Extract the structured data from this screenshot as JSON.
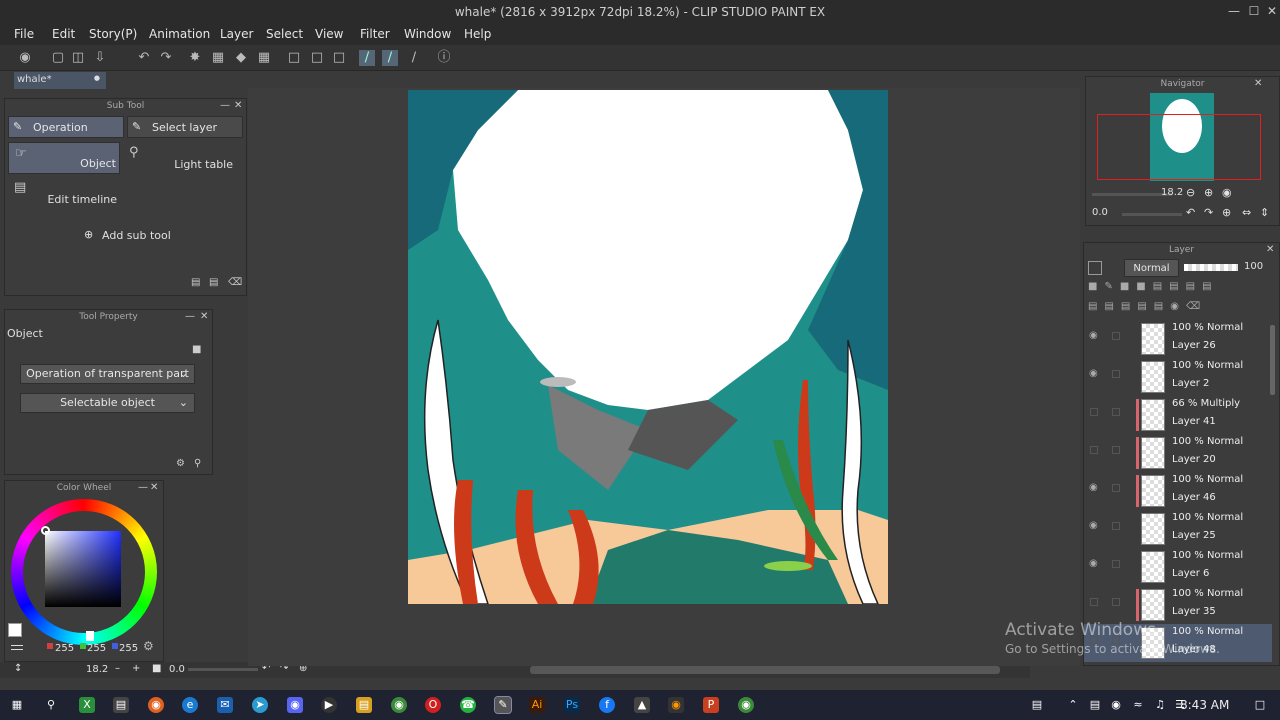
{
  "window": {
    "title": "whale* (2816 x 3912px 72dpi 18.2%) - CLIP STUDIO PAINT EX"
  },
  "menu": [
    "File",
    "Edit",
    "Story(P)",
    "Animation",
    "Layer",
    "Select",
    "View",
    "Filter",
    "Window",
    "Help"
  ],
  "document_tab": {
    "label": "whale*"
  },
  "subtool": {
    "title": "Sub Tool",
    "operation": "Operation",
    "select_layer": "Select layer",
    "object": "Object",
    "light_table": "Light table",
    "edit_timeline": "Edit timeline",
    "add_sub_tool": "Add sub tool"
  },
  "tool_property": {
    "title": "Tool Property",
    "object": "Object",
    "transparent_part": "Operation of transparent part",
    "selectable_object": "Selectable object"
  },
  "color_wheel": {
    "title": "Color Wheel",
    "r": "255",
    "g": "255",
    "b": "255",
    "r_color": "#d04040",
    "g_color": "#40c040",
    "b_color": "#4060e0"
  },
  "bottom_bar": {
    "zoom": "18.2",
    "angle": "0.0"
  },
  "navigator": {
    "title": "Navigator",
    "zoom": "18.2",
    "angle": "0.0"
  },
  "layer_panel": {
    "title": "Layer",
    "blend_mode": "Normal",
    "opacity": "100",
    "layers": [
      {
        "mode": "100 % Normal",
        "name": "Layer 26",
        "visible": true,
        "marked": false
      },
      {
        "mode": "100 % Normal",
        "name": "Layer 2",
        "visible": true,
        "marked": false
      },
      {
        "mode": "66 % Multiply",
        "name": "Layer 41",
        "visible": false,
        "marked": true
      },
      {
        "mode": "100 % Normal",
        "name": "Layer 20",
        "visible": false,
        "marked": true
      },
      {
        "mode": "100 % Normal",
        "name": "Layer 46",
        "visible": true,
        "marked": true
      },
      {
        "mode": "100 % Normal",
        "name": "Layer 25",
        "visible": true,
        "marked": false
      },
      {
        "mode": "100 % Normal",
        "name": "Layer 6",
        "visible": true,
        "marked": false
      },
      {
        "mode": "100 % Normal",
        "name": "Layer 35",
        "visible": false,
        "marked": true
      },
      {
        "mode": "100 % Normal",
        "name": "Layer 48",
        "visible": false,
        "marked": false
      }
    ]
  },
  "watermark": {
    "line1": "Activate Windows",
    "line2": "Go to Settings to activate Windows."
  },
  "taskbar": {
    "time": "8:43 AM"
  },
  "colors": {
    "accent": "#556677",
    "layer_mark": "#d9646b",
    "teal": "#1f8f8a"
  }
}
